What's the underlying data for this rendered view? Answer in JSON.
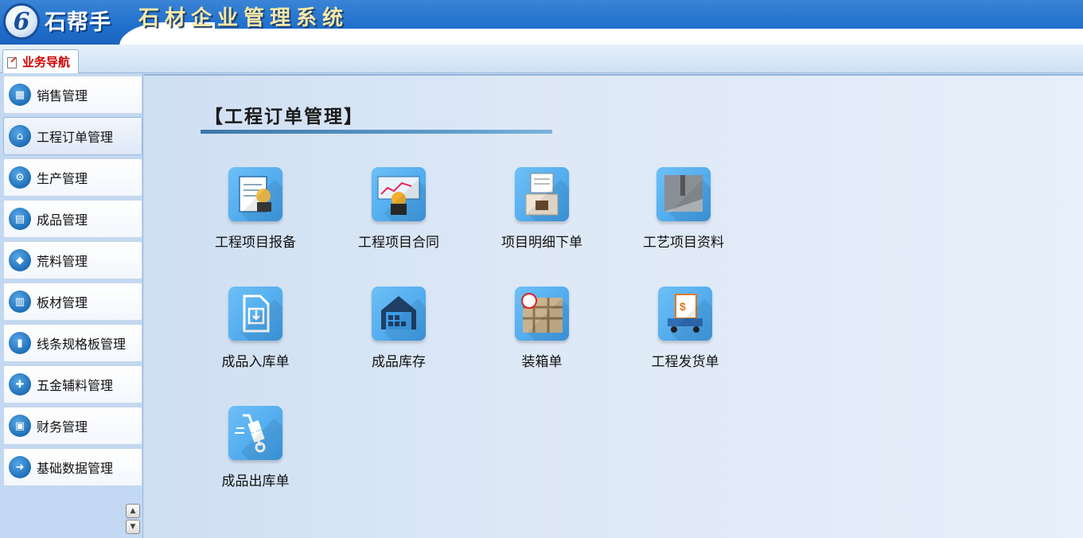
{
  "header": {
    "logo_glyph": "6",
    "brand": "石帮手",
    "system_title": "石材企业管理系统"
  },
  "tabs": [
    {
      "label": "业务导航",
      "icon": "document-edit-icon"
    }
  ],
  "sidebar": {
    "items": [
      {
        "label": "销售管理",
        "icon": "sales-icon"
      },
      {
        "label": "工程订单管理",
        "icon": "engineering-order-icon"
      },
      {
        "label": "生产管理",
        "icon": "production-icon"
      },
      {
        "label": "成品管理",
        "icon": "finished-goods-icon"
      },
      {
        "label": "荒料管理",
        "icon": "raw-block-icon"
      },
      {
        "label": "板材管理",
        "icon": "slab-icon"
      },
      {
        "label": "线条规格板管理",
        "icon": "line-spec-board-icon"
      },
      {
        "label": "五金辅料管理",
        "icon": "hardware-icon"
      },
      {
        "label": "财务管理",
        "icon": "finance-icon"
      },
      {
        "label": "基础数据管理",
        "icon": "base-data-icon"
      }
    ],
    "active_index": 1
  },
  "main": {
    "section_title": "【工程订单管理】",
    "apps": [
      {
        "label": "工程项目报备",
        "icon": "project-report-icon"
      },
      {
        "label": "工程项目合同",
        "icon": "project-contract-icon"
      },
      {
        "label": "项目明细下单",
        "icon": "detail-order-icon"
      },
      {
        "label": "工艺项目资料",
        "icon": "process-data-icon"
      },
      {
        "label": "成品入库单",
        "icon": "stock-in-icon"
      },
      {
        "label": "成品库存",
        "icon": "warehouse-icon"
      },
      {
        "label": "装箱单",
        "icon": "packing-icon"
      },
      {
        "label": "工程发货单",
        "icon": "shipping-icon"
      },
      {
        "label": "成品出库单",
        "icon": "stock-out-icon"
      }
    ]
  },
  "colors": {
    "header_blue": "#1f6fcc",
    "title_gold": "#f7e9a8",
    "tab_red": "#d00000",
    "tile_blue": "#3d9de8"
  }
}
